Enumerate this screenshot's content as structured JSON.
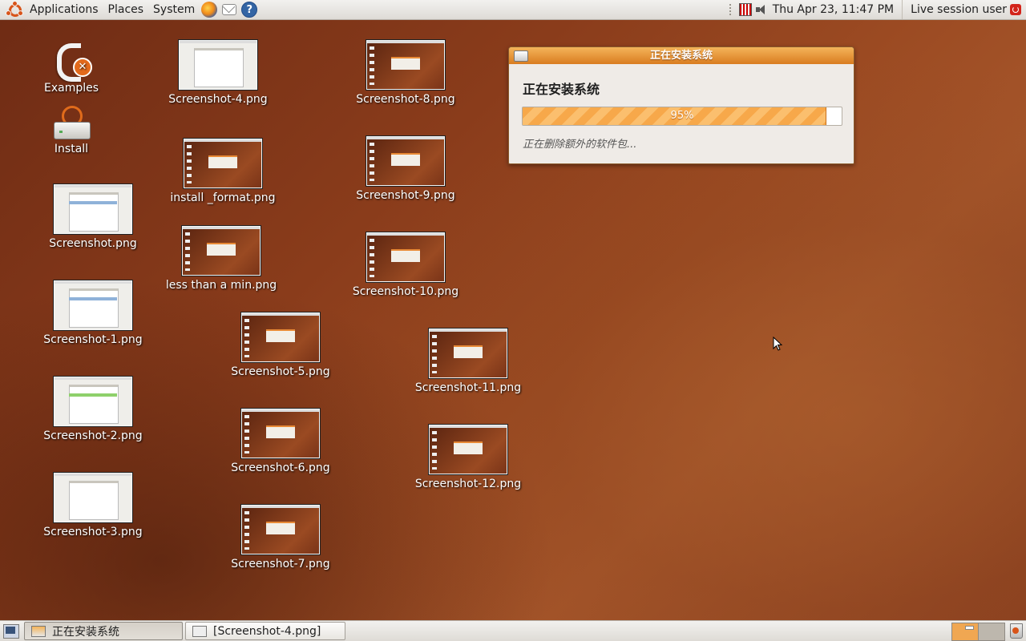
{
  "top_panel": {
    "menus": [
      "Applications",
      "Places",
      "System"
    ],
    "clock": "Thu Apr 23, 11:47 PM",
    "session": "Live session user"
  },
  "desktop": {
    "icons": [
      {
        "label": "Examples"
      },
      {
        "label": "Install"
      },
      {
        "label": "Screenshot.png"
      },
      {
        "label": "Screenshot-1.png"
      },
      {
        "label": "Screenshot-2.png"
      },
      {
        "label": "Screenshot-3.png"
      },
      {
        "label": "Screenshot-4.png"
      },
      {
        "label": "install _format.png"
      },
      {
        "label": "less than a min.png"
      },
      {
        "label": "Screenshot-5.png"
      },
      {
        "label": "Screenshot-6.png"
      },
      {
        "label": "Screenshot-7.png"
      },
      {
        "label": "Screenshot-8.png"
      },
      {
        "label": "Screenshot-9.png"
      },
      {
        "label": "Screenshot-10.png"
      },
      {
        "label": "Screenshot-11.png"
      },
      {
        "label": "Screenshot-12.png"
      }
    ]
  },
  "installer": {
    "title": "正在安装系统",
    "heading": "正在安装系统",
    "progress_percent": 95,
    "progress_label": "95%",
    "status": "正在删除额外的软件包..."
  },
  "taskbar": {
    "tasks": [
      {
        "label": "正在安装系统",
        "active": true
      },
      {
        "label": "[Screenshot-4.png]",
        "active": false
      }
    ]
  },
  "colors": {
    "accent": "#f0a752",
    "titlebar": "#d97c20",
    "desktop": "#8a3c1b"
  },
  "icons": {
    "menu_logo": "ubuntu-logo-icon",
    "launchers": [
      "firefox-icon",
      "mail-icon",
      "help-icon"
    ],
    "tray": [
      "network-icon",
      "volume-icon",
      "power-icon"
    ],
    "trash": "trash-icon"
  }
}
